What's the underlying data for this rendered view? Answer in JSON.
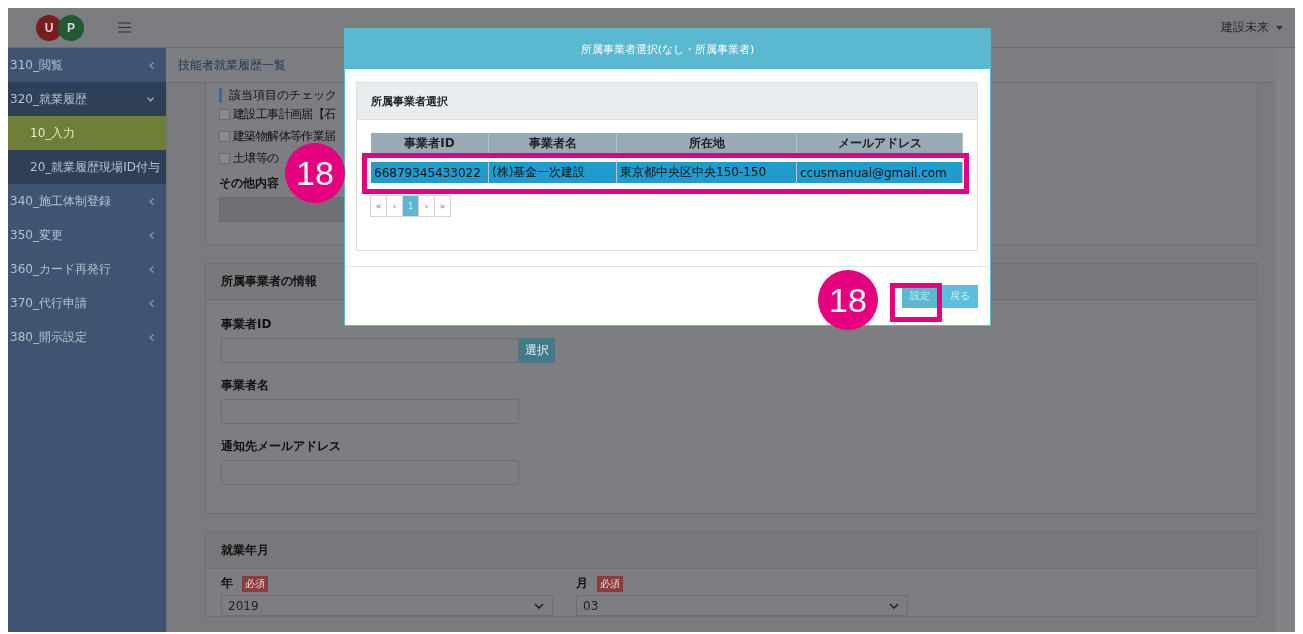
{
  "header": {
    "logo_letters": [
      "U",
      "P"
    ],
    "user": "建設未来"
  },
  "sidebar": {
    "items": [
      {
        "label": "310_閲覧",
        "expanded": false
      },
      {
        "label": "320_就業履歴",
        "expanded": true,
        "children": [
          {
            "label": "10_入力",
            "selected": true
          },
          {
            "label": "20_就業履歴現場ID付与",
            "selected": false
          }
        ]
      },
      {
        "label": "340_施工体制登録",
        "expanded": false
      },
      {
        "label": "350_変更",
        "expanded": false
      },
      {
        "label": "360_カード再発行",
        "expanded": false
      },
      {
        "label": "370_代行申請",
        "expanded": false
      },
      {
        "label": "380_開示設定",
        "expanded": false
      }
    ]
  },
  "breadcrumb": "技能者就業履歴一覧",
  "check_section": {
    "note": "該当項目のチェック",
    "checkboxes": [
      {
        "label": "建設工事計画届【石",
        "checked": false
      },
      {
        "label": "建築物解体等作業届",
        "checked": false
      },
      {
        "label": "土壌等の",
        "checked": false
      }
    ],
    "other_label": "その他内容"
  },
  "company_section": {
    "title": "所属事業者の情報",
    "fields": [
      {
        "label": "事業者ID",
        "button": "選択"
      },
      {
        "label": "事業者名"
      },
      {
        "label": "通知先メールアドレス"
      }
    ]
  },
  "period_section": {
    "title": "就業年月",
    "selects": [
      {
        "label": "年",
        "badge": "必須",
        "value": "2019"
      },
      {
        "label": "月",
        "badge": "必須",
        "value": "03"
      }
    ]
  },
  "modal": {
    "title": "所属事業者選択(なし・所属事業者)",
    "panel_title": "所属事業者選択",
    "columns": [
      "事業者ID",
      "事業者名",
      "所在地",
      "メールアドレス"
    ],
    "rows": [
      {
        "cells": [
          "66879345433022",
          "(株)基金一次建設",
          "東京都中央区中央150-150",
          "ccusmanual@gmail.com"
        ],
        "selected": true
      }
    ],
    "pagination": [
      {
        "label": "«",
        "selected": false
      },
      {
        "label": "‹",
        "selected": false
      },
      {
        "label": "1",
        "selected": true
      },
      {
        "label": "›",
        "selected": false
      },
      {
        "label": "»",
        "selected": false
      }
    ],
    "buttons": [
      {
        "label": "設定",
        "kind": "primary"
      },
      {
        "label": "戻る",
        "kind": "secondary"
      }
    ]
  },
  "annotations": [
    {
      "number": "18"
    },
    {
      "number": "18"
    }
  ]
}
